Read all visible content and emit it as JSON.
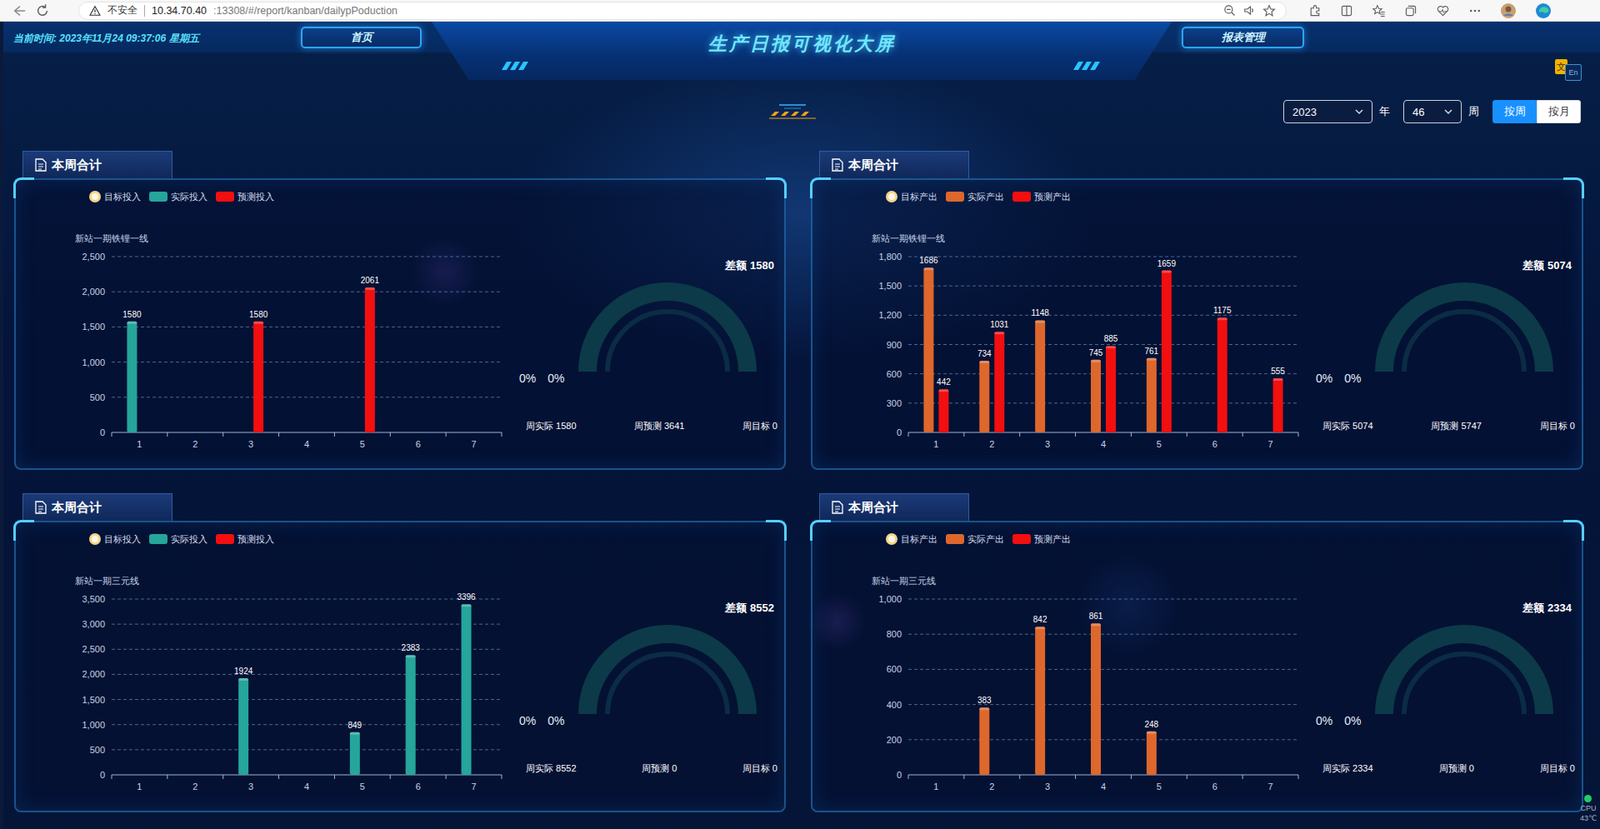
{
  "browser": {
    "security": "不安全",
    "url_host": "10.34.70.40",
    "url_path": ":13308/#/report/kanban/dailypPoduction"
  },
  "header": {
    "clock": "当前时间: 2023年11月24 09:37:06 星期五",
    "title": "生产日报可视化大屏",
    "nav": [
      {
        "label": "首页"
      },
      {
        "label": "报表管理"
      }
    ]
  },
  "lang_toggle": {
    "zh": "文",
    "en": "En"
  },
  "filters": {
    "year": "2023",
    "year_unit": "年",
    "week": "46",
    "week_unit": "周",
    "modes": [
      {
        "label": "按周",
        "selected": true
      },
      {
        "label": "按月",
        "selected": false
      }
    ]
  },
  "panels": [
    {
      "title": "本周合计",
      "legend": [
        {
          "label": "目标投入",
          "kind": "ring",
          "color": "#f6d48a"
        },
        {
          "label": "实际投入",
          "kind": "bar",
          "color": "#26a59b"
        },
        {
          "label": "预测投入",
          "kind": "bar",
          "color": "#f20f0f"
        }
      ],
      "chart": {
        "series_label": "新站一期铁锂一线",
        "y_ticks": [
          "0",
          "500",
          "1,000",
          "1,500",
          "2,000",
          "2,500"
        ],
        "y_max": 2500,
        "x_labels": [
          "1",
          "2",
          "3",
          "4",
          "5",
          "6",
          "7"
        ],
        "series": [
          {
            "color": "#26a59b",
            "values": [
              1580,
              0,
              0,
              0,
              0,
              0,
              0
            ]
          },
          {
            "color": "#f20f0f",
            "values": [
              0,
              0,
              1580,
              0,
              2061,
              0,
              0
            ]
          }
        ]
      },
      "summary": {
        "diff": "差额 1580",
        "percents": [
          "0%",
          "0%"
        ],
        "level": 0,
        "stats": [
          "周实际 1580",
          "周预测 3641",
          "周目标 0"
        ]
      }
    },
    {
      "title": "本周合计",
      "legend": [
        {
          "label": "目标产出",
          "kind": "ring",
          "color": "#f6d48a"
        },
        {
          "label": "实际产出",
          "kind": "bar",
          "color": "#de672c"
        },
        {
          "label": "预测产出",
          "kind": "bar",
          "color": "#f20f0f"
        }
      ],
      "chart": {
        "series_label": "新站一期铁锂一线",
        "y_ticks": [
          "0",
          "300",
          "600",
          "900",
          "1,200",
          "1,500",
          "1,800"
        ],
        "y_max": 1800,
        "x_labels": [
          "1",
          "2",
          "3",
          "4",
          "5",
          "6",
          "7"
        ],
        "series": [
          {
            "color": "#de672c",
            "values": [
              1686,
              734,
              1148,
              745,
              761,
              0,
              0
            ]
          },
          {
            "color": "#f20f0f",
            "values": [
              442,
              1031,
              0,
              885,
              1659,
              1175,
              555
            ]
          }
        ]
      },
      "summary": {
        "diff": "差额 5074",
        "percents": [
          "0%",
          "0%"
        ],
        "level": 0,
        "stats": [
          "周实际 5074",
          "周预测 5747",
          "周目标 0"
        ]
      }
    },
    {
      "title": "本周合计",
      "legend": [
        {
          "label": "目标投入",
          "kind": "ring",
          "color": "#f6d48a"
        },
        {
          "label": "实际投入",
          "kind": "bar",
          "color": "#26a59b"
        },
        {
          "label": "预测投入",
          "kind": "bar",
          "color": "#f20f0f"
        }
      ],
      "chart": {
        "series_label": "新站一期三元线",
        "y_ticks": [
          "0",
          "500",
          "1,000",
          "1,500",
          "2,000",
          "2,500",
          "3,000",
          "3,500"
        ],
        "y_max": 3500,
        "x_labels": [
          "1",
          "2",
          "3",
          "4",
          "5",
          "6",
          "7"
        ],
        "series": [
          {
            "color": "#26a59b",
            "values": [
              0,
              0,
              1924,
              0,
              849,
              2383,
              3396
            ]
          },
          {
            "color": "#f20f0f",
            "values": [
              0,
              0,
              0,
              0,
              0,
              0,
              0
            ]
          }
        ]
      },
      "summary": {
        "diff": "差额 8552",
        "percents": [
          "0%",
          "0%"
        ],
        "level": 0,
        "stats": [
          "周实际 8552",
          "周预测 0",
          "周目标 0"
        ]
      }
    },
    {
      "title": "本周合计",
      "legend": [
        {
          "label": "目标产出",
          "kind": "ring",
          "color": "#f6d48a"
        },
        {
          "label": "实际产出",
          "kind": "bar",
          "color": "#de672c"
        },
        {
          "label": "预测产出",
          "kind": "bar",
          "color": "#f20f0f"
        }
      ],
      "chart": {
        "series_label": "新站一期三元线",
        "y_ticks": [
          "0",
          "200",
          "400",
          "600",
          "800",
          "1,000"
        ],
        "y_max": 1000,
        "x_labels": [
          "1",
          "2",
          "3",
          "4",
          "5",
          "6",
          "7"
        ],
        "series": [
          {
            "color": "#de672c",
            "values": [
              0,
              383,
              842,
              861,
              248,
              0,
              0
            ]
          },
          {
            "color": "#f20f0f",
            "values": [
              0,
              0,
              0,
              0,
              0,
              0,
              0
            ]
          }
        ]
      },
      "summary": {
        "diff": "差额 2334",
        "percents": [
          "0%",
          "0%"
        ],
        "level": 0,
        "stats": [
          "周实际 2334",
          "周预测 0",
          "周目标 0"
        ]
      }
    }
  ],
  "cpu_widget": {
    "label": "CPU",
    "value": "43℃"
  }
}
